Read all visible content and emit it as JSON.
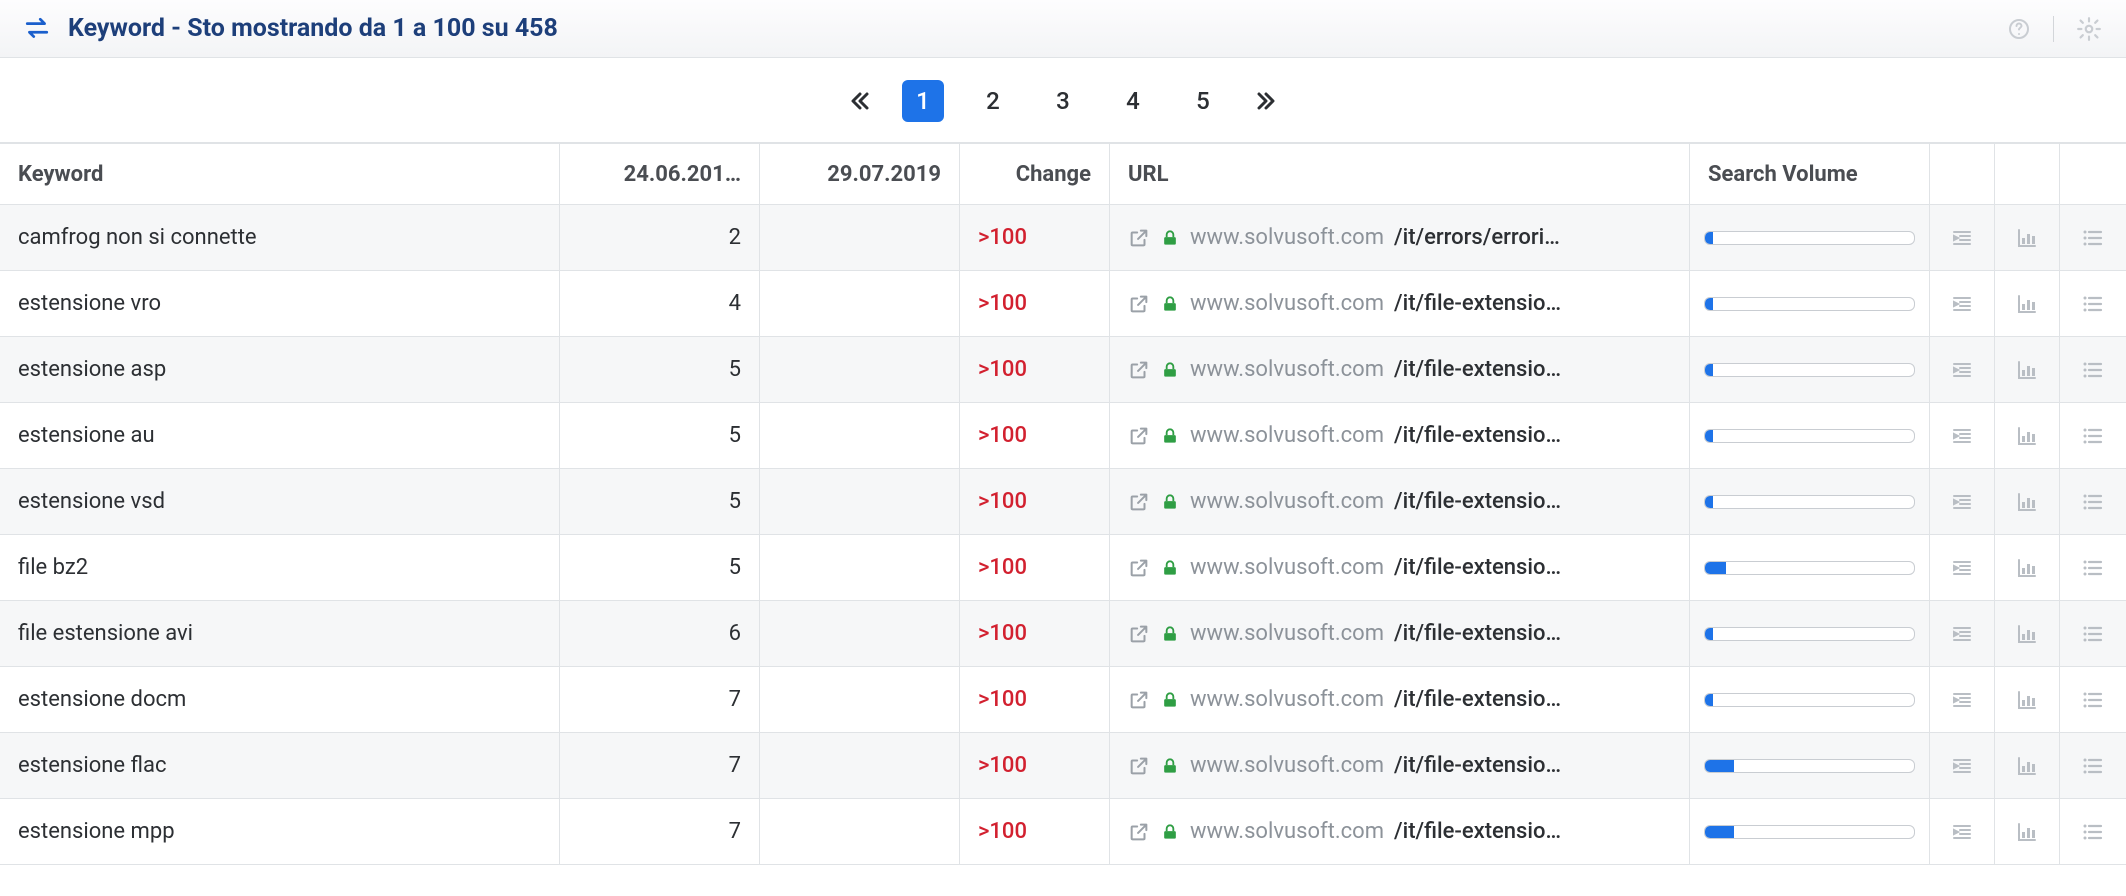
{
  "header": {
    "title": "Keyword - Sto mostrando da 1 a 100 su 458"
  },
  "pagination": {
    "pages": [
      "1",
      "2",
      "3",
      "4",
      "5"
    ],
    "active": "1"
  },
  "columns": {
    "keyword": "Keyword",
    "date1": "24.06.201…",
    "date2": "29.07.2019",
    "change": "Change",
    "url": "URL",
    "volume": "Search Volume"
  },
  "rows": [
    {
      "keyword": "camfrog non si connette",
      "d1": "2",
      "d2": "",
      "change": ">100",
      "domain": "www.solvusoft.com",
      "path": "/it/errors/errori…",
      "vol": 4
    },
    {
      "keyword": "estensione vro",
      "d1": "4",
      "d2": "",
      "change": ">100",
      "domain": "www.solvusoft.com",
      "path": "/it/file-extensio…",
      "vol": 4
    },
    {
      "keyword": "estensione asp",
      "d1": "5",
      "d2": "",
      "change": ">100",
      "domain": "www.solvusoft.com",
      "path": "/it/file-extensio…",
      "vol": 4
    },
    {
      "keyword": "estensione au",
      "d1": "5",
      "d2": "",
      "change": ">100",
      "domain": "www.solvusoft.com",
      "path": "/it/file-extensio…",
      "vol": 4
    },
    {
      "keyword": "estensione vsd",
      "d1": "5",
      "d2": "",
      "change": ">100",
      "domain": "www.solvusoft.com",
      "path": "/it/file-extensio…",
      "vol": 4
    },
    {
      "keyword": "file bz2",
      "d1": "5",
      "d2": "",
      "change": ">100",
      "domain": "www.solvusoft.com",
      "path": "/it/file-extensio…",
      "vol": 10
    },
    {
      "keyword": "file estensione avi",
      "d1": "6",
      "d2": "",
      "change": ">100",
      "domain": "www.solvusoft.com",
      "path": "/it/file-extensio…",
      "vol": 4
    },
    {
      "keyword": "estensione docm",
      "d1": "7",
      "d2": "",
      "change": ">100",
      "domain": "www.solvusoft.com",
      "path": "/it/file-extensio…",
      "vol": 4
    },
    {
      "keyword": "estensione flac",
      "d1": "7",
      "d2": "",
      "change": ">100",
      "domain": "www.solvusoft.com",
      "path": "/it/file-extensio…",
      "vol": 14
    },
    {
      "keyword": "estensione mpp",
      "d1": "7",
      "d2": "",
      "change": ">100",
      "domain": "www.solvusoft.com",
      "path": "/it/file-extensio…",
      "vol": 14
    }
  ]
}
